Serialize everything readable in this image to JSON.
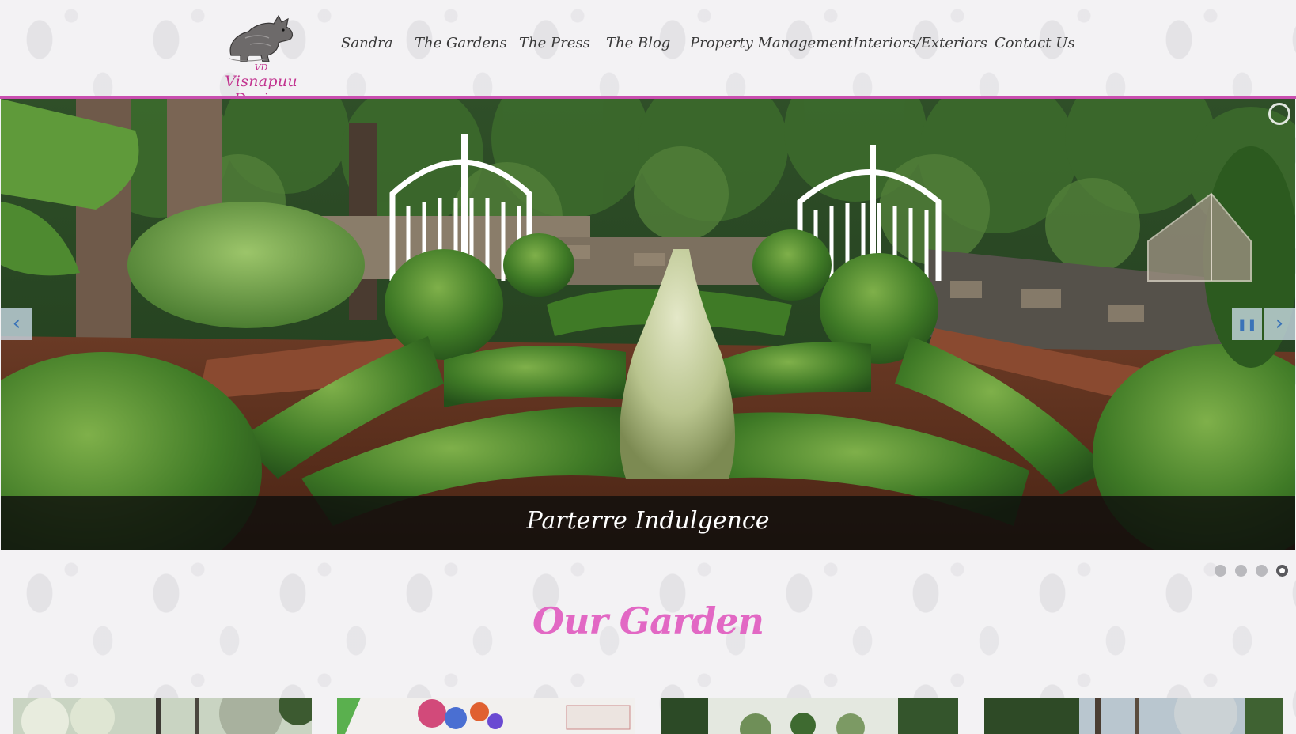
{
  "brand": {
    "monogram": "VD",
    "name": "Visnapuu Design",
    "logo_color": "#c2338f",
    "accent": "#c94fb0"
  },
  "nav": [
    {
      "label": "Sandra"
    },
    {
      "label": "The Gardens"
    },
    {
      "label": "The Press"
    },
    {
      "label": "The Blog"
    },
    {
      "label": "Property Management"
    },
    {
      "label": "Interiors/Exteriors"
    },
    {
      "label": "Contact Us"
    }
  ],
  "slider": {
    "caption": "Parterre Indulgence",
    "prev_icon": "chevron-left-icon",
    "next_icon": "chevron-right-icon",
    "pause_icon": "pause-icon",
    "loader_icon": "loading-ring-icon",
    "slide_count": 4,
    "active_slide": 4
  },
  "section": {
    "title": "Our Garden",
    "title_color": "#e268c4"
  },
  "gallery": [
    {
      "subject": "flowering trees"
    },
    {
      "subject": "painting"
    },
    {
      "subject": "garden path"
    },
    {
      "subject": "woodland"
    }
  ]
}
